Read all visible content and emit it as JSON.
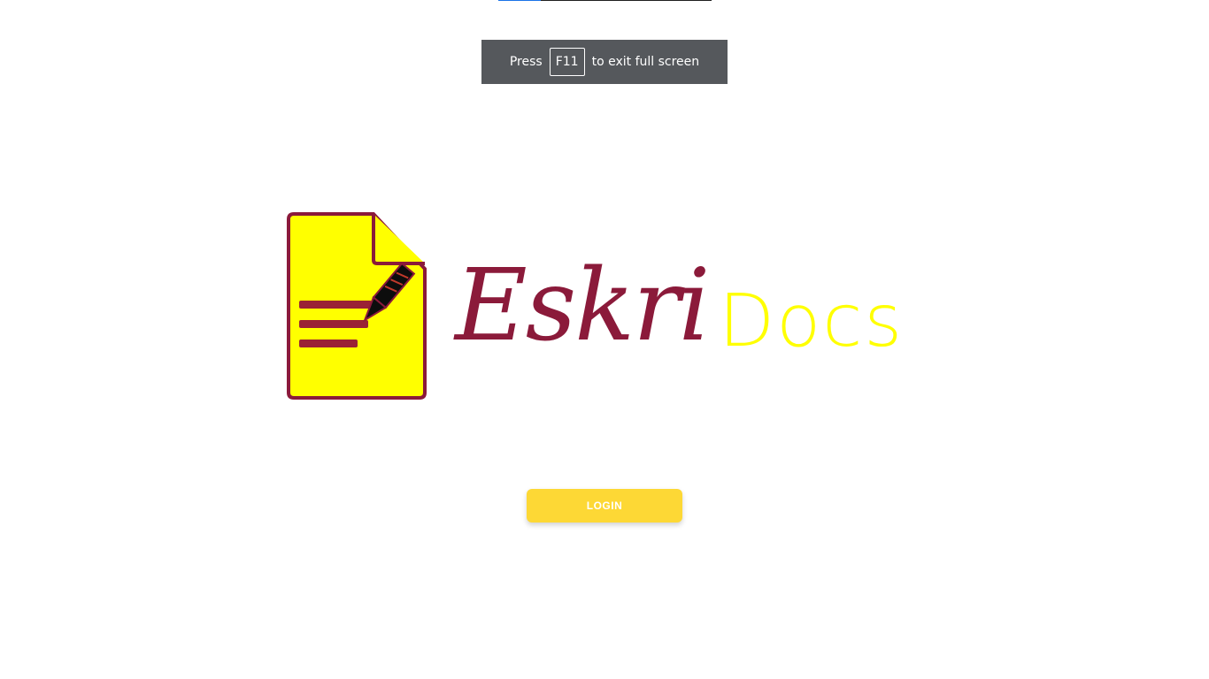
{
  "loading_bar": {
    "progress": 0.2,
    "fill_color": "#1a73e8",
    "track_color": "#1f1f1f"
  },
  "fullscreen_notice": {
    "prefix": "Press",
    "key": "F11",
    "suffix": "to exit full screen"
  },
  "logo": {
    "script_text": "Eskri",
    "docs_text": "Docs",
    "icon": "document-pen-icon",
    "colors": {
      "maroon": "#8b1a3a",
      "yellow": "#ffff00"
    }
  },
  "login": {
    "label": "LOGIN",
    "color": "#fdd835"
  }
}
